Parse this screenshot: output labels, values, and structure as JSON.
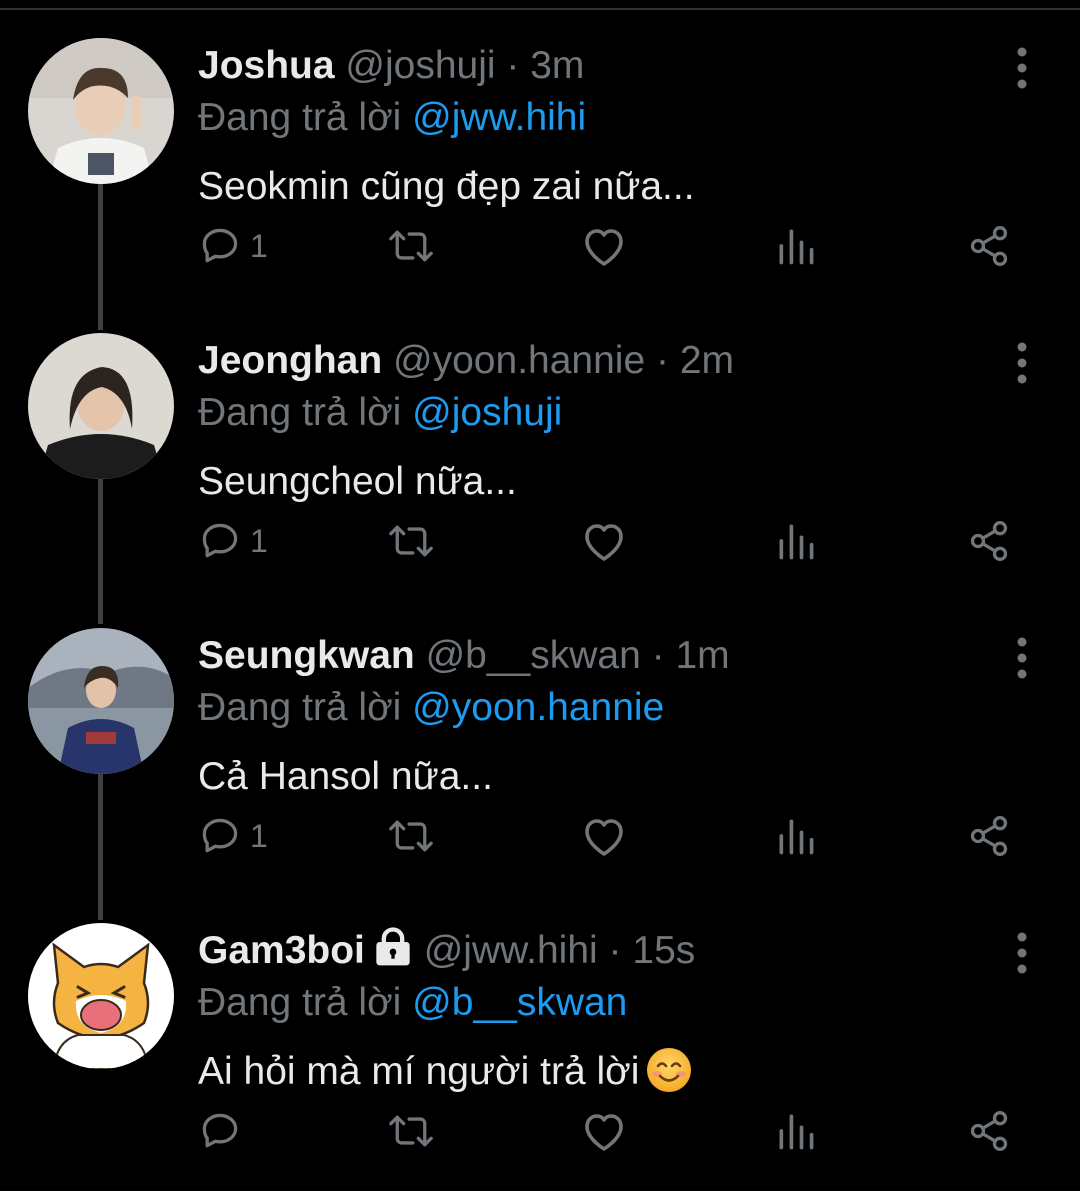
{
  "reply_prefix": "Đang trả lời",
  "tweets": [
    {
      "name": "Joshua",
      "handle": "@joshuji",
      "time": "3m",
      "replying_to": "@jww.hihi",
      "text": "Seokmin cũng đẹp zai nữa...",
      "reply_count": "1",
      "locked": false
    },
    {
      "name": "Jeonghan",
      "handle": "@yoon.hannie",
      "time": "2m",
      "replying_to": "@joshuji",
      "text": "Seungcheol nữa...",
      "reply_count": "1",
      "locked": false
    },
    {
      "name": "Seungkwan",
      "handle": "@b__skwan",
      "time": "1m",
      "replying_to": "@yoon.hannie",
      "text": "Cả Hansol nữa...",
      "reply_count": "1",
      "locked": false
    },
    {
      "name": "Gam3boi",
      "handle": "@jww.hihi",
      "time": "15s",
      "replying_to": "@b__skwan",
      "text": "Ai hỏi mà mí người trả lời",
      "reply_count": "",
      "locked": true,
      "emoji": "smiling-face-emoji"
    }
  ],
  "colors": {
    "background": "#000000",
    "primary_text": "#e7e9ea",
    "secondary_text": "#71767b",
    "mention": "#1d9bf0",
    "thread_line": "#3e4144"
  },
  "icons": [
    "more-vertical-icon",
    "reply-icon",
    "retweet-icon",
    "like-icon",
    "views-icon",
    "share-icon",
    "lock-icon"
  ]
}
